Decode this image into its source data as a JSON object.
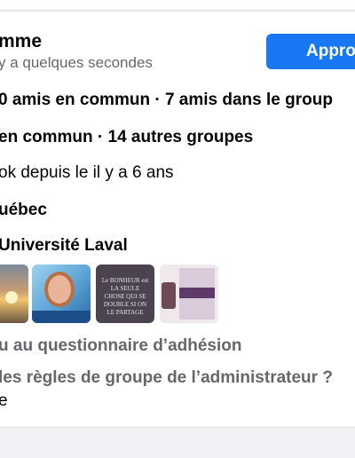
{
  "member": {
    "name": "mme",
    "time": "y a quelques secondes"
  },
  "actions": {
    "approve_label": "Approuver"
  },
  "details": {
    "mutual": "0 amis en commun · 7 amis dans le group",
    "groups": "en commun · 14 autres groupes",
    "facebook_since": "ok depuis le il y a 6 ans",
    "location": "uébec",
    "school": "Université Laval"
  },
  "thumbnails": {
    "quote_text": "Le BONHEUR est LA SEULE CHOSE QUI SE DOUBLE SI ON LE PARTAGE"
  },
  "questionnaire": {
    "answered": "u au questionnaire d’adhésion",
    "rules_question": "les règles de groupe de l’administrateur ?",
    "rules_answer": "e"
  }
}
